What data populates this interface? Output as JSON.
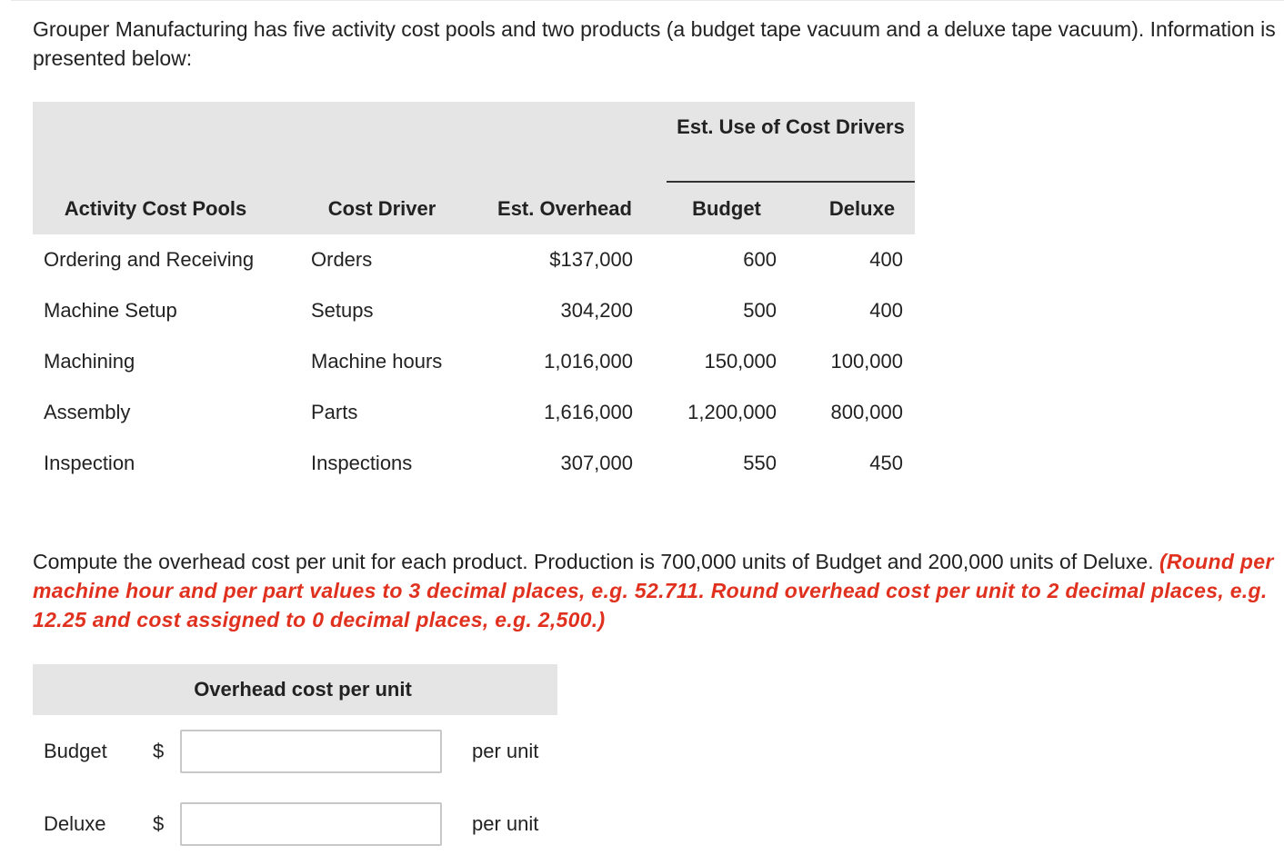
{
  "intro": "Grouper Manufacturing has five activity cost pools and two products (a budget tape vacuum and a deluxe tape vacuum). Information is presented below:",
  "table": {
    "group_header": "Est. Use of Cost Drivers",
    "headers": [
      "Activity Cost Pools",
      "Cost Driver",
      "Est. Overhead",
      "Budget",
      "Deluxe"
    ],
    "rows": [
      {
        "pool": "Ordering and Receiving",
        "driver": "Orders",
        "overhead": "$137,000",
        "budget": "600",
        "deluxe": "400"
      },
      {
        "pool": "Machine Setup",
        "driver": "Setups",
        "overhead": "304,200",
        "budget": "500",
        "deluxe": "400"
      },
      {
        "pool": "Machining",
        "driver": "Machine hours",
        "overhead": "1,016,000",
        "budget": "150,000",
        "deluxe": "100,000"
      },
      {
        "pool": "Assembly",
        "driver": "Parts",
        "overhead": "1,616,000",
        "budget": "1,200,000",
        "deluxe": "800,000"
      },
      {
        "pool": "Inspection",
        "driver": "Inspections",
        "overhead": "307,000",
        "budget": "550",
        "deluxe": "450"
      }
    ]
  },
  "question": {
    "text": "Compute the overhead cost per unit for each product. Production is 700,000 units of Budget and 200,000 units of Deluxe.",
    "instruction": "(Round per machine hour and per part values to 3 decimal places, e.g. 52.711. Round overhead cost per unit to 2 decimal places, e.g. 12.25 and cost assigned to 0 decimal places, e.g. 2,500.)"
  },
  "answer": {
    "title": "Overhead cost per unit",
    "currency": "$",
    "unit_label": "per unit",
    "rows": [
      {
        "label": "Budget",
        "value": ""
      },
      {
        "label": "Deluxe",
        "value": ""
      }
    ]
  },
  "colors": {
    "instruction": "#e0311f",
    "header_bg": "#e5e5e5",
    "input_border": "#c8c8c8"
  }
}
